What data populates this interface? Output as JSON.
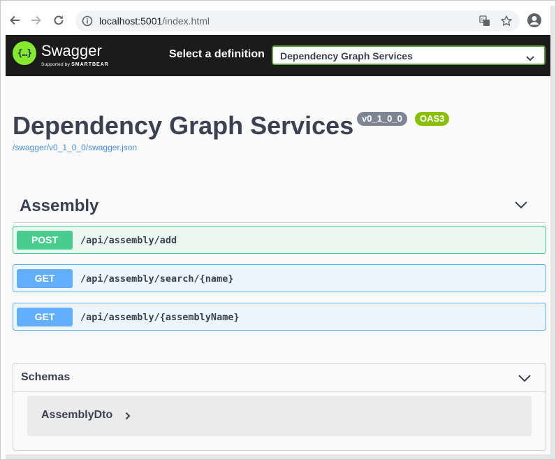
{
  "browser": {
    "url_host": "localhost:5001",
    "url_path": "/index.html",
    "icons": [
      "back-icon",
      "forward-icon",
      "reload-icon",
      "info-icon",
      "translate-icon",
      "star-icon",
      "profile-icon"
    ]
  },
  "topbar": {
    "brand": "Swagger",
    "brand_sub_prefix": "Supported by ",
    "brand_sub_company": "SMARTBEAR",
    "logo_glyph": "{…}",
    "definition_label": "Select a definition",
    "definition_value": "Dependency Graph Services",
    "accent_color": "#85ea2d"
  },
  "info": {
    "title": "Dependency Graph Services",
    "version": "v0_1_0_0",
    "oas": "OAS3",
    "spec_link": "/swagger/v0_1_0_0/swagger.json"
  },
  "tag": {
    "name": "Assembly",
    "operations": [
      {
        "method": "POST",
        "path": "/api/assembly/add"
      },
      {
        "method": "GET",
        "path": "/api/assembly/search/{name}"
      },
      {
        "method": "GET",
        "path": "/api/assembly/{assemblyName}"
      }
    ]
  },
  "schemas": {
    "title": "Schemas",
    "models": [
      "AssemblyDto"
    ]
  },
  "colors": {
    "post": "#49cc90",
    "get": "#61affe",
    "version_badge": "#7d8492",
    "oas_badge": "#89bf04"
  }
}
